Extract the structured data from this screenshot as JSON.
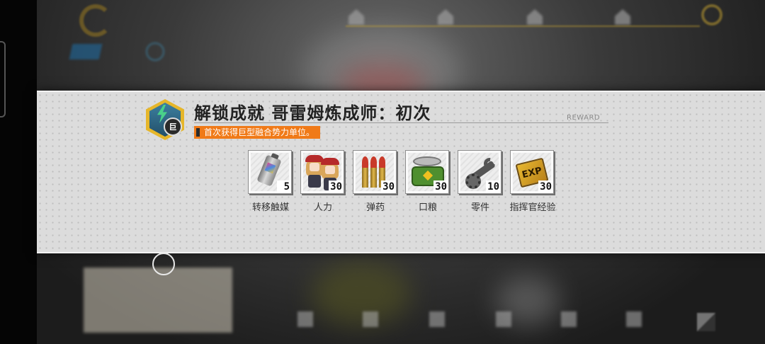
{
  "colors": {
    "banner_bg": "#dcdcdc",
    "desc_bg": "#f07a18",
    "badge_border": "#e6b62a",
    "badge_fill": "#3c7fa0",
    "bolt": "#49d18a"
  },
  "achievement": {
    "badge_icon": "lightning-hex-icon",
    "badge_chip": "巨",
    "title": "解锁成就  哥雷姆炼成师：初次",
    "reward_tag": "REWARD",
    "description": "首次获得巨型融合势力单位。"
  },
  "rewards": [
    {
      "icon": "transfer-catalyst-icon",
      "name": "转移触媒",
      "count": "5"
    },
    {
      "icon": "manpower-icon",
      "name": "人力",
      "count": "30"
    },
    {
      "icon": "ammo-icon",
      "name": "弹药",
      "count": "30"
    },
    {
      "icon": "rations-icon",
      "name": "口粮",
      "count": "30"
    },
    {
      "icon": "parts-icon",
      "name": "零件",
      "count": "10"
    },
    {
      "icon": "commander-exp-icon",
      "name": "指挥官经验",
      "count": "30"
    }
  ],
  "exp_icon_text": "EXP"
}
